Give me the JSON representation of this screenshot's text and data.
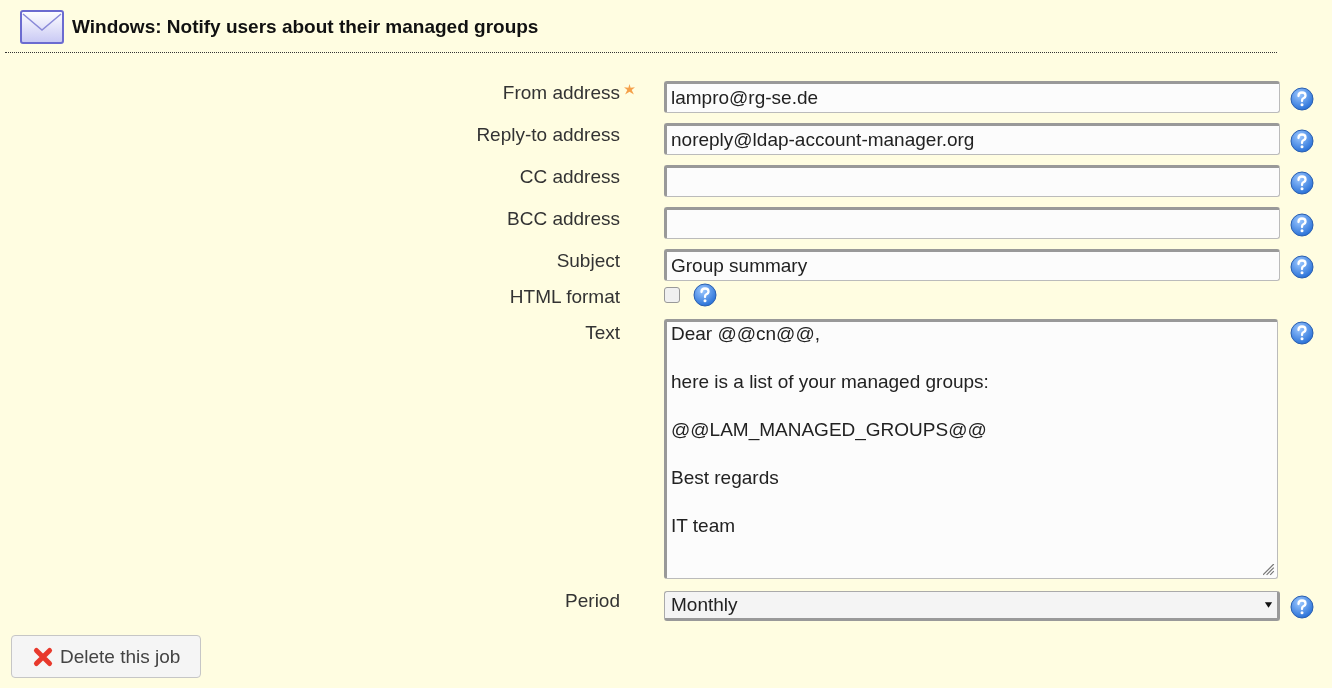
{
  "header": {
    "title": "Windows: Notify users about their managed groups"
  },
  "fields": [
    {
      "kind": "text",
      "label": "From address",
      "required": true,
      "value": "lampro@rg-se.de"
    },
    {
      "kind": "text",
      "label": "Reply-to address",
      "required": false,
      "value": "noreply@ldap-account-manager.org"
    },
    {
      "kind": "text",
      "label": "CC address",
      "required": false
    },
    {
      "kind": "text",
      "label": "BCC address",
      "required": false
    },
    {
      "kind": "text",
      "label": "Subject",
      "required": false,
      "value": "Group summary"
    },
    {
      "kind": "checkbox",
      "label": "HTML format",
      "required": false,
      "checked": false
    },
    {
      "kind": "textarea",
      "label": "Text",
      "required": false,
      "value": "Dear @@cn@@,\n\nhere is a list of your managed groups:\n\n@@LAM_MANAGED_GROUPS@@\n\nBest regards\n\nIT team"
    },
    {
      "kind": "select",
      "label": "Period",
      "required": false,
      "value": "Monthly"
    }
  ],
  "delete_button": {
    "label": "Delete this job"
  }
}
